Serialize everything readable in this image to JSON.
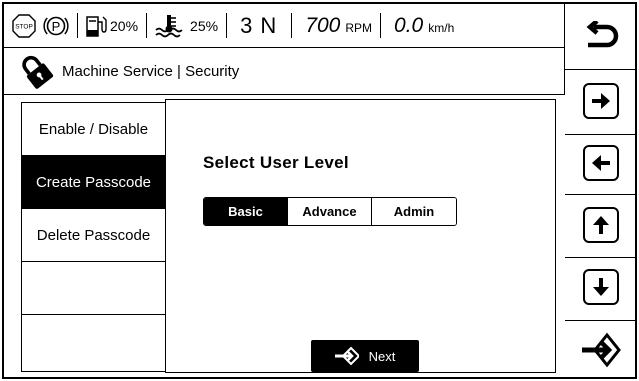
{
  "status": {
    "stop_label": "STOP",
    "park_label": "P",
    "fuel_percent": "20%",
    "temp_percent": "25%",
    "gear": "3 N",
    "rpm_value": "700",
    "rpm_unit": "RPM",
    "speed_value": "0.0",
    "speed_unit": "km/h",
    "icons": [
      "stop-sign-icon",
      "parking-brake-icon",
      "fuel-icon",
      "coolant-temperature-icon"
    ]
  },
  "header": {
    "title": "Machine Service | Security",
    "icon": "lock-icon"
  },
  "menu": {
    "items": [
      {
        "label": "Enable / Disable",
        "active": false
      },
      {
        "label": "Create Passcode",
        "active": true
      },
      {
        "label": "Delete Passcode",
        "active": false
      },
      {
        "label": "",
        "active": false
      },
      {
        "label": "",
        "active": false
      }
    ]
  },
  "main": {
    "heading": "Select User Level",
    "levels": [
      {
        "label": "Basic",
        "selected": true
      },
      {
        "label": "Advance",
        "selected": false
      },
      {
        "label": "Admin",
        "selected": false
      }
    ],
    "next_label": "Next"
  },
  "rail": {
    "buttons": [
      "back-icon",
      "arrow-right-icon",
      "arrow-left-icon",
      "arrow-up-icon",
      "arrow-down-icon",
      "enter-icon"
    ]
  },
  "colors": {
    "foreground": "#000000",
    "background": "#ffffff",
    "active_fill": "#000000",
    "active_text": "#ffffff"
  }
}
